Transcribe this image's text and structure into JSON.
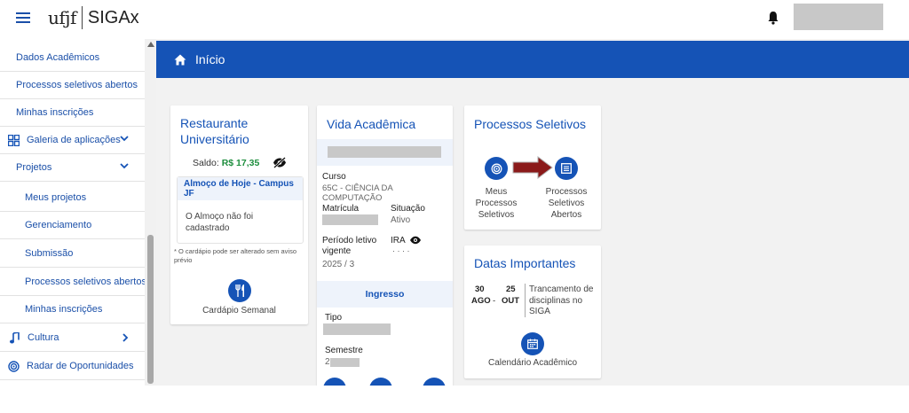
{
  "header": {
    "logo_ufjf": "ufjf",
    "logo_siga": "SIGAx"
  },
  "sidebar": {
    "items": [
      {
        "label": "Dados Acadêmicos"
      },
      {
        "label": "Processos seletivos abertos"
      },
      {
        "label": "Minhas inscrições"
      },
      {
        "label": "Galeria de aplicações"
      },
      {
        "label": "Projetos"
      },
      {
        "label": "Meus projetos"
      },
      {
        "label": "Gerenciamento"
      },
      {
        "label": "Submissão"
      },
      {
        "label": "Processos seletivos abertos"
      },
      {
        "label": "Minhas inscrições"
      },
      {
        "label": "Cultura"
      },
      {
        "label": "Radar de Oportunidades"
      }
    ]
  },
  "banner": {
    "title": "Início"
  },
  "restaurante": {
    "title_line1": "Restaurante",
    "title_line2": "Universitário",
    "saldo_label": "Saldo: ",
    "saldo_value": "R$ 17,35",
    "almoco_title": "Almoço de Hoje - Campus JF",
    "almoco_text_line1": "O Almoço não foi",
    "almoco_text_line2": "cadastrado",
    "note_line1": "* O cardápio pode ser alterado sem aviso",
    "note_line2": "prévio",
    "cardapio_label": "Cardápio Semanal"
  },
  "vida": {
    "title": "Vida Acadêmica",
    "curso_label": "Curso",
    "curso_value": "65C - CIÊNCIA DA COMPUTAÇÃO",
    "matricula_label": "Matrícula",
    "situacao_label": "Situação",
    "situacao_value": "Ativo",
    "periodo_label_line1": "Período letivo",
    "periodo_label_line2": "vigente",
    "periodo_value": "2025 / 3",
    "ira_label": "IRA",
    "ira_value": "· · · ·",
    "ingresso_title": "Ingresso",
    "tipo_label": "Tipo",
    "semestre_label": "Semestre",
    "semestre_value_prefix": "2"
  },
  "processos": {
    "title": "Processos Seletivos",
    "meus_line1": "Meus",
    "meus_line2": "Processos",
    "meus_line3": "Seletivos",
    "abertos_line1": "Processos",
    "abertos_line2": "Seletivos",
    "abertos_line3": "Abertos"
  },
  "datas": {
    "title": "Datas Importantes",
    "day_start": "30",
    "day_end": "25",
    "month_start": "AGO",
    "separator": "-",
    "month_end": "OUT",
    "event_line1": "Trancamento de",
    "event_line2": "disciplinas no",
    "event_line3": "SIGA",
    "calendario_label": "Calendário Acadêmico"
  },
  "colors": {
    "primary": "#1553b6",
    "saldo": "#1e8e3e",
    "arrow": "#8b1a1a"
  }
}
